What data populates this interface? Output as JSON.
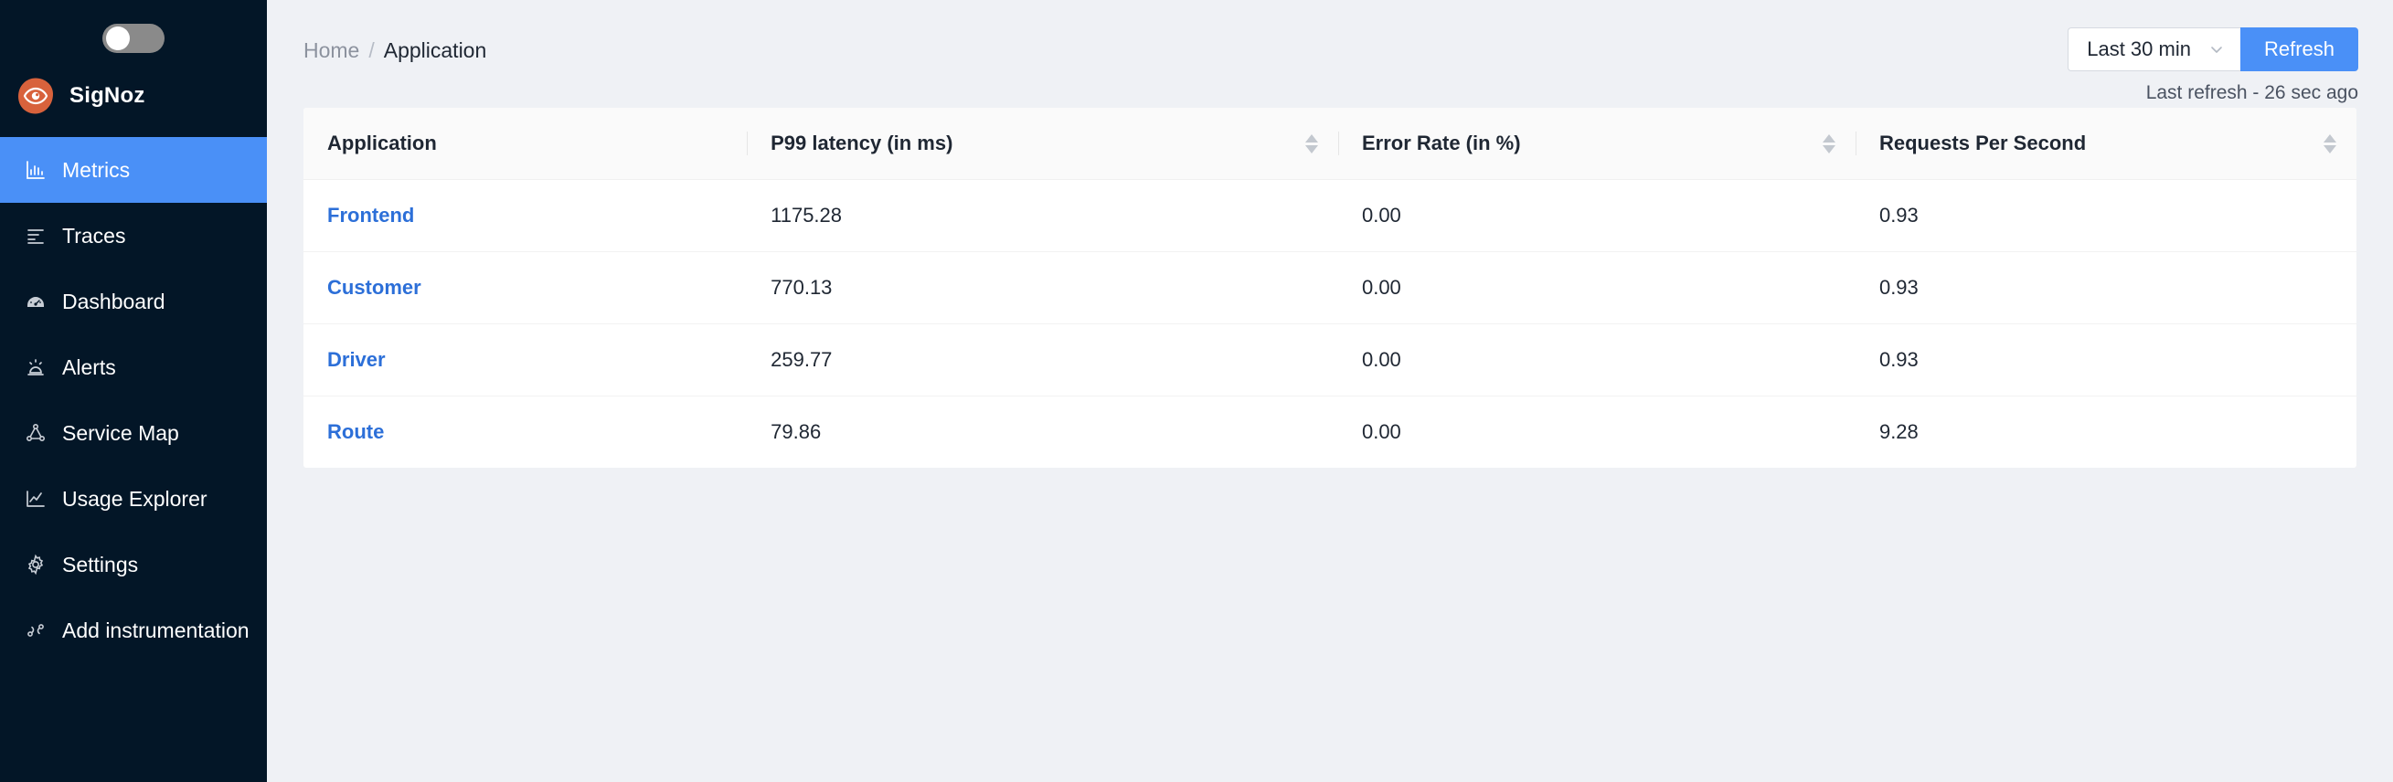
{
  "sidebar": {
    "theme_toggle": {
      "name": "theme-toggle",
      "state": "off"
    },
    "brand": {
      "name": "SigNoz",
      "logo_icon": "signoz-eye-logo-icon"
    },
    "items": [
      {
        "label": "Metrics",
        "icon": "bar-chart-icon",
        "active": true
      },
      {
        "label": "Traces",
        "icon": "align-left-list-icon",
        "active": false
      },
      {
        "label": "Dashboard",
        "icon": "dashboard-gauge-icon",
        "active": false
      },
      {
        "label": "Alerts",
        "icon": "alert-siren-icon",
        "active": false
      },
      {
        "label": "Service Map",
        "icon": "node-network-icon",
        "active": false
      },
      {
        "label": "Usage Explorer",
        "icon": "line-chart-icon",
        "active": false
      },
      {
        "label": "Settings",
        "icon": "gear-icon",
        "active": false
      },
      {
        "label": "Add instrumentation",
        "icon": "dna-instrument-icon",
        "active": false
      }
    ]
  },
  "header": {
    "breadcrumb": {
      "home_label": "Home",
      "separator": "/",
      "current_label": "Application"
    },
    "time_range": {
      "selected": "Last 30 min",
      "chevron_icon": "chevron-down-icon"
    },
    "refresh_label": "Refresh",
    "last_refresh": "Last refresh - 26 sec ago"
  },
  "table": {
    "columns": [
      {
        "label": "Application",
        "sortable": false
      },
      {
        "label": "P99 latency (in ms)",
        "sortable": true
      },
      {
        "label": "Error Rate (in %)",
        "sortable": true
      },
      {
        "label": "Requests Per Second",
        "sortable": true
      }
    ],
    "rows": [
      {
        "application": "Frontend",
        "p99": "1175.28",
        "error_rate": "0.00",
        "rps": "0.93"
      },
      {
        "application": "Customer",
        "p99": "770.13",
        "error_rate": "0.00",
        "rps": "0.93"
      },
      {
        "application": "Driver",
        "p99": "259.77",
        "error_rate": "0.00",
        "rps": "0.93"
      },
      {
        "application": "Route",
        "p99": "79.86",
        "error_rate": "0.00",
        "rps": "9.28"
      }
    ]
  },
  "colors": {
    "sidebar_bg": "#031627",
    "accent_blue": "#4a90f7",
    "link_blue": "#2c6fd8",
    "page_bg": "#eff1f5",
    "brand_orange": "#d8623c"
  }
}
